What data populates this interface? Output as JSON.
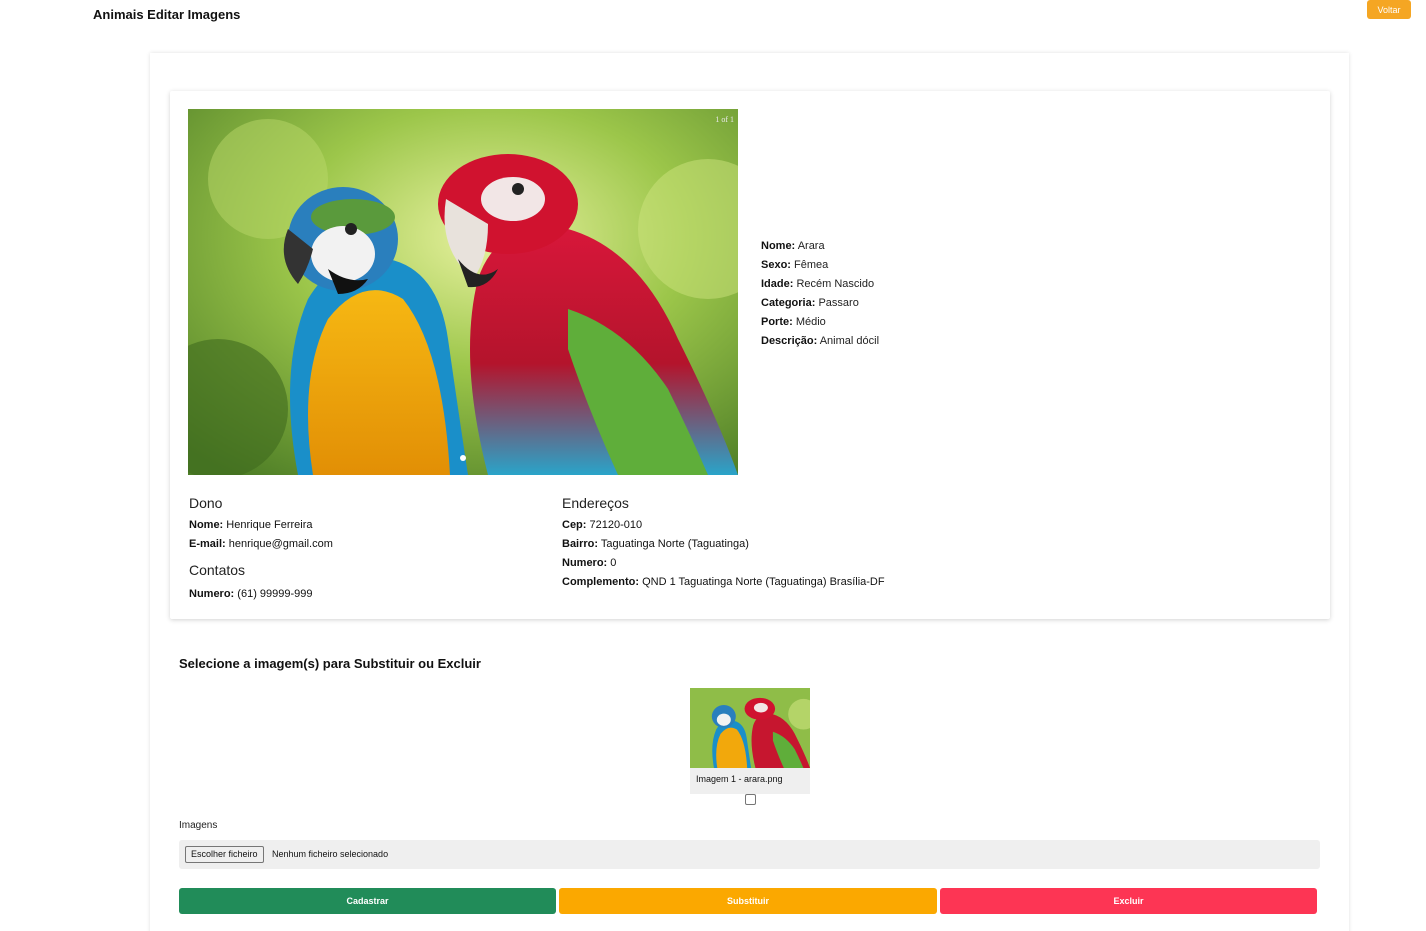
{
  "header": {
    "title": "Animais Editar Imagens",
    "back_label": "Voltar"
  },
  "carousel": {
    "counter": "1 of 1",
    "image_icon": "parrots-photo"
  },
  "animal": [
    {
      "label": "Nome:",
      "value": "Arara"
    },
    {
      "label": "Sexo:",
      "value": "Fêmea"
    },
    {
      "label": "Idade:",
      "value": "Recém Nascido"
    },
    {
      "label": "Categoria:",
      "value": "Passaro"
    },
    {
      "label": "Porte:",
      "value": "Médio"
    },
    {
      "label": "Descrição:",
      "value": "Animal dócil"
    }
  ],
  "owner": {
    "heading": "Dono",
    "name_label": "Nome:",
    "name_value": "Henrique Ferreira",
    "email_label": "E-mail:",
    "email_value": "henrique@gmail.com",
    "contacts_heading": "Contatos",
    "phone_label": "Numero:",
    "phone_value": "(61) 99999-999"
  },
  "address": {
    "heading": "Endereços",
    "cep_label": "Cep:",
    "cep_value": "72120-010",
    "bairro_label": "Bairro:",
    "bairro_value": "Taguatinga Norte (Taguatinga)",
    "numero_label": "Numero:",
    "numero_value": "0",
    "complemento_label": "Complemento:",
    "complemento_value": "QND 1 Taguatinga Norte (Taguatinga) Brasília-DF"
  },
  "selection": {
    "title": "Selecione a imagem(s) para Substituir ou Excluir",
    "thumb_label": "Imagem 1 - arara.png"
  },
  "upload": {
    "label": "Imagens",
    "button": "Escolher ficheiro",
    "status": "Nenhum ficheiro selecionado"
  },
  "actions": {
    "cadastrar": "Cadastrar",
    "substituir": "Substituir",
    "excluir": "Excluir"
  },
  "colors": {
    "green": "#218c59",
    "orange": "#fba800",
    "red": "#fd3554",
    "back": "#f5a623"
  }
}
